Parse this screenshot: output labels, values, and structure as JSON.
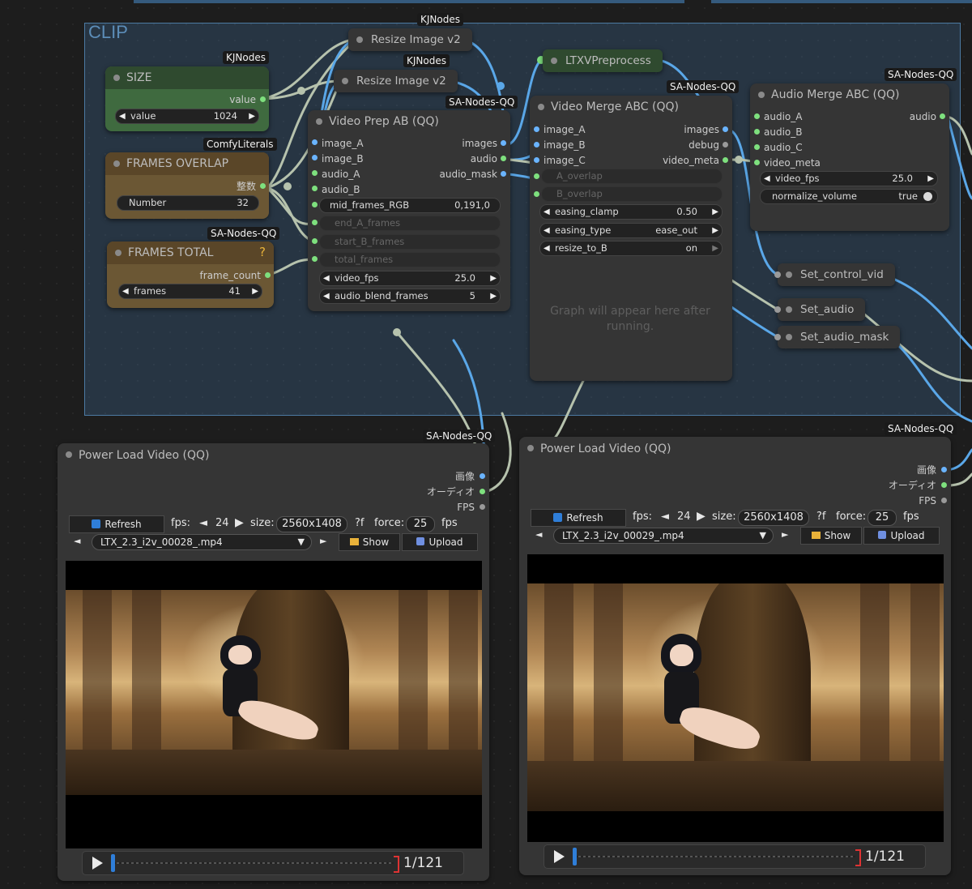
{
  "group": {
    "title": "CLIP"
  },
  "badges": {
    "kj1": "KJNodes",
    "kj2": "KJNodes",
    "kj3": "KJNodes",
    "comfy": "ComfyLiterals",
    "sa_total": "SA-Nodes-QQ",
    "sa_prep": "SA-Nodes-QQ",
    "sa_merge": "SA-Nodes-QQ",
    "sa_audio": "SA-Nodes-QQ",
    "sa_load1": "SA-Nodes-QQ",
    "sa_load2": "SA-Nodes-QQ"
  },
  "size_node": {
    "title": "SIZE",
    "output": "value",
    "widget_label": "value",
    "widget_value": "1024"
  },
  "frames_overlap": {
    "title": "FRAMES OVERLAP",
    "output": "整数",
    "widget_label": "Number",
    "widget_value": "32"
  },
  "frames_total": {
    "title": "FRAMES TOTAL",
    "output": "frame_count",
    "widget_label": "frames",
    "widget_value": "41",
    "help": "?"
  },
  "resize1": {
    "title": "Resize Image v2"
  },
  "resize2": {
    "title": "Resize Image v2"
  },
  "ltxv": {
    "title": "LTXVPreprocess"
  },
  "video_prep": {
    "title": "Video Prep AB (QQ)",
    "inputs": [
      "image_A",
      "image_B",
      "audio_A",
      "audio_B"
    ],
    "outputs": [
      "images",
      "audio",
      "audio_mask"
    ],
    "w_mid_label": "mid_frames_RGB",
    "w_mid_value": "0,191,0",
    "w_end_a": "end_A_frames",
    "w_start_b": "start_B_frames",
    "w_total": "total_frames",
    "w_fps_label": "video_fps",
    "w_fps_value": "25.0",
    "w_blend_label": "audio_blend_frames",
    "w_blend_value": "5"
  },
  "video_merge": {
    "title": "Video Merge ABC (QQ)",
    "inputs": [
      "image_A",
      "image_B",
      "image_C"
    ],
    "outputs": [
      "images",
      "debug",
      "video_meta"
    ],
    "w_a_overlap": "A_overlap",
    "w_b_overlap": "B_overlap",
    "w_easing_clamp_label": "easing_clamp",
    "w_easing_clamp_value": "0.50",
    "w_easing_type_label": "easing_type",
    "w_easing_type_value": "ease_out",
    "w_resize_label": "resize_to_B",
    "w_resize_value": "on",
    "placeholder": "Graph will appear here after running."
  },
  "audio_merge": {
    "title": "Audio Merge ABC (QQ)",
    "inputs": [
      "audio_A",
      "audio_B",
      "audio_C",
      "video_meta"
    ],
    "output": "audio",
    "w_fps_label": "video_fps",
    "w_fps_value": "25.0",
    "w_norm_label": "normalize_volume",
    "w_norm_value": "true"
  },
  "set_nodes": [
    "Set_control_vid",
    "Set_audio",
    "Set_audio_mask"
  ],
  "loaders": [
    {
      "title": "Power Load Video (QQ)",
      "outputs": [
        "画像",
        "オーディオ",
        "FPS"
      ],
      "refresh": "Refresh",
      "fps_label": "fps:",
      "fps_value": "24",
      "size_label": "size:",
      "size_value": "2560x1408",
      "f_label": "?f",
      "force_label": "force:",
      "force_value": "25",
      "fps_unit": "fps",
      "file": "LTX_2.3_i2v_00028_.mp4",
      "show": "Show",
      "upload": "Upload",
      "frame_counter": "1/121"
    },
    {
      "title": "Power Load Video (QQ)",
      "outputs": [
        "画像",
        "オーディオ",
        "FPS"
      ],
      "refresh": "Refresh",
      "fps_label": "fps:",
      "fps_value": "24",
      "size_label": "size:",
      "size_value": "2560x1408",
      "f_label": "?f",
      "force_label": "force:",
      "force_value": "25",
      "fps_unit": "fps",
      "file": "LTX_2.3_i2v_00029_.mp4",
      "show": "Show",
      "upload": "Upload",
      "frame_counter": "1/121"
    }
  ],
  "colors": {
    "image_port": "#6ab4ff",
    "audio_port": "#7ee07e",
    "group_fill": "#3c648c",
    "size_header": "#2f4a2f",
    "frames_header": "#5a4628"
  }
}
